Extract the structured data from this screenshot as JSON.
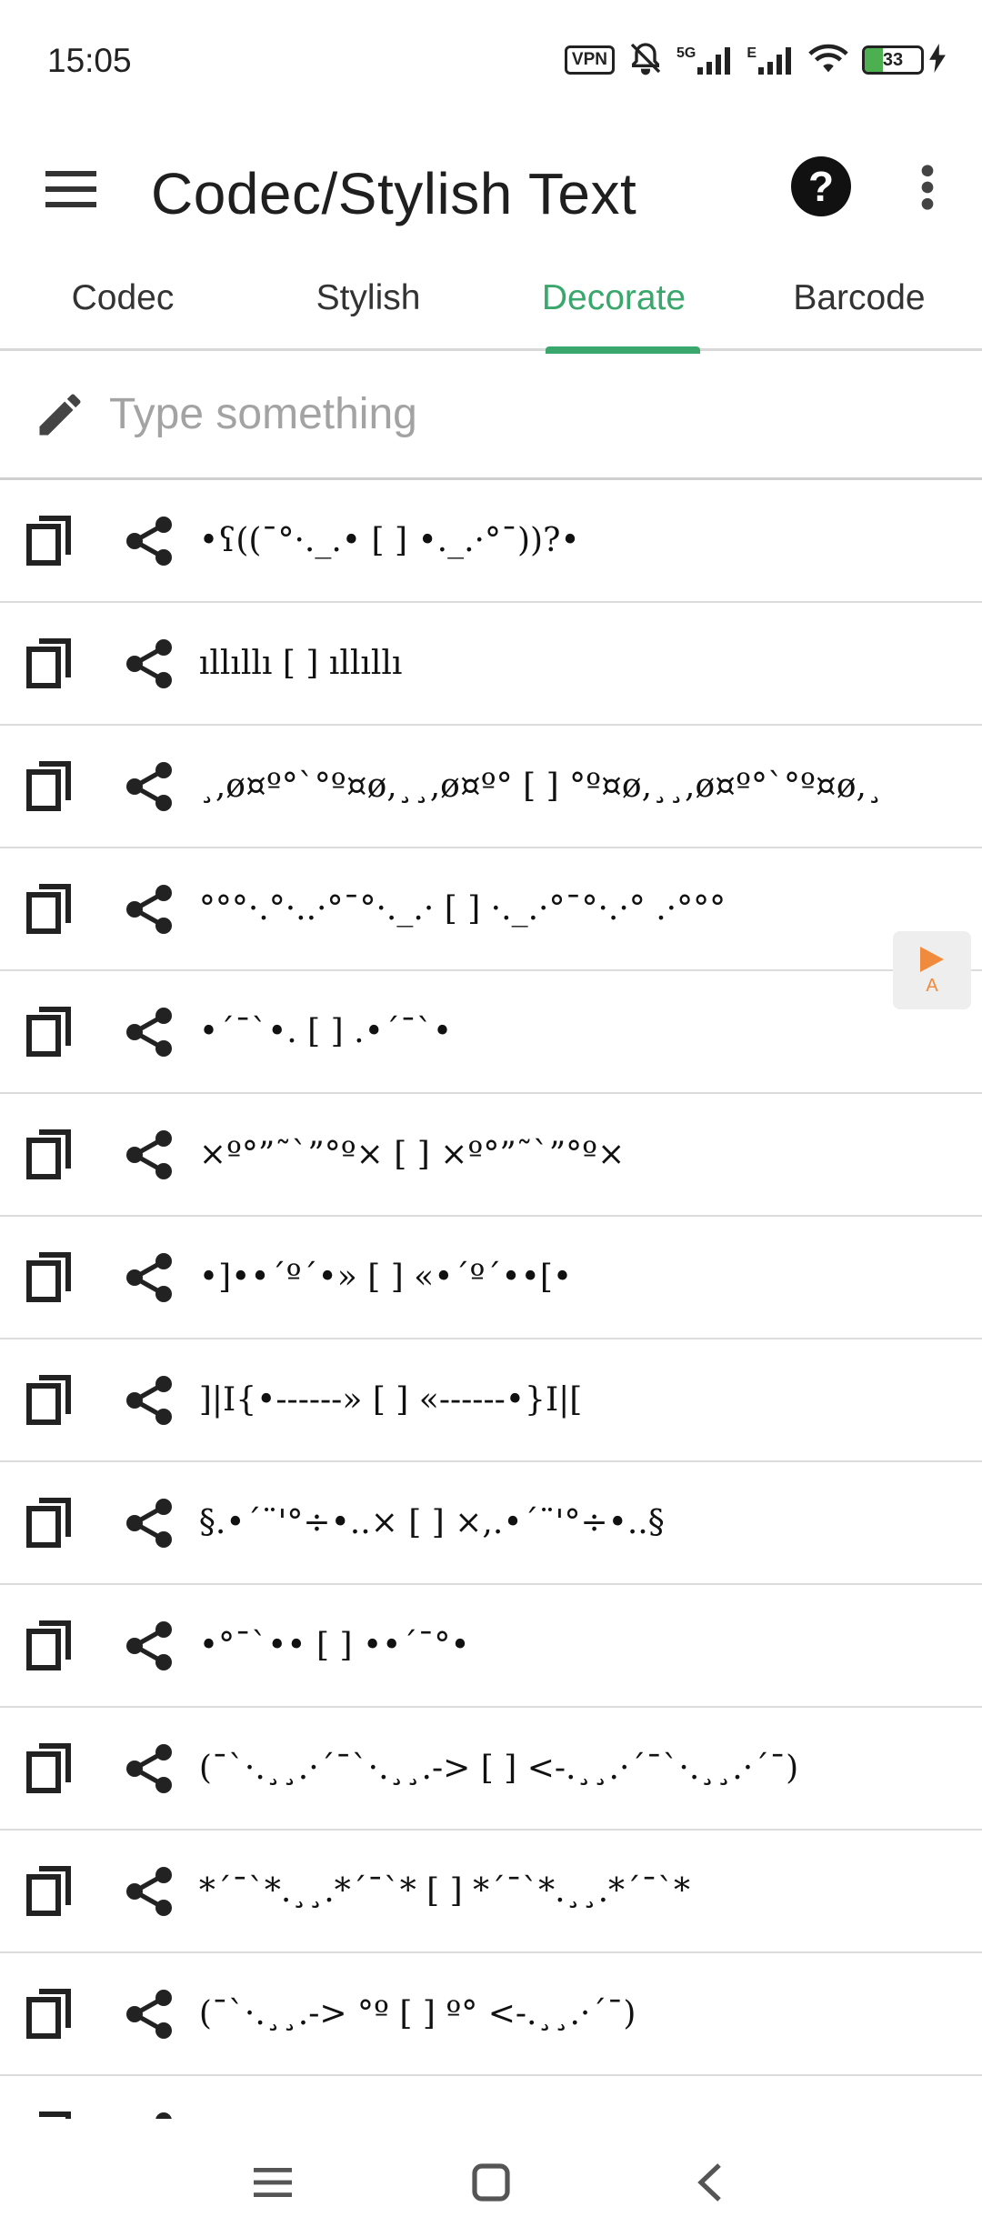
{
  "status_bar": {
    "time": "15:05",
    "vpn": "VPN",
    "network": "5G",
    "network2": "E",
    "battery": "33",
    "battery_level": 0.33
  },
  "app_bar": {
    "title": "Codec/Stylish Text",
    "help": "?"
  },
  "tabs": [
    {
      "label": "Codec"
    },
    {
      "label": "Stylish"
    },
    {
      "label": "Decorate"
    },
    {
      "label": "Barcode"
    }
  ],
  "active_tab": "Decorate",
  "input": {
    "placeholder": "Type something",
    "value": ""
  },
  "rows": [
    {
      "text": "•ʕ((¯°·._.• [  ] •._.·°¯))?•"
    },
    {
      "text": "ıllıllı [  ] ıllıllı"
    },
    {
      "text": "¸,ø¤º°`°º¤ø,¸¸,ø¤º° [  ] °º¤ø,¸¸,ø¤º°`°º¤ø,¸"
    },
    {
      "text": "°°°·.°·..·°¯°·._.· [  ] ·._.·°¯°·.·° .·°°°"
    },
    {
      "text": "•´¯`•. [  ] .•´¯`•"
    },
    {
      "text": "×º°”˜`”°º× [  ] ×º°”˜`”°º×"
    },
    {
      "text": "•]••´º´•» [  ] «•´º´••[•"
    },
    {
      "text": "]|I{•------» [  ] «------•}I|["
    },
    {
      "text": "§.•´¨'°÷•..× [  ] ×,.•´¨'°÷•..§"
    },
    {
      "text": "•°¯`•• [  ] ••´¯°•"
    },
    {
      "text": "(¯`·.¸¸.·´¯`·.¸¸.-> [  ] <-.¸¸.·´¯`·.¸¸.·´¯)"
    },
    {
      "text": "*´¯`*.¸¸.*´¯`* [  ] *´¯`*.¸¸.*´¯`*"
    },
    {
      "text": "(¯`·.¸¸.-> °º [  ] º° <-.¸¸.·´¯)"
    },
    {
      "text": ""
    }
  ],
  "floating_button": {
    "label": "A",
    "accent": "#f08a3c"
  },
  "colors": {
    "accent": "#3aa76d"
  },
  "icons": {
    "menu": "menu-icon",
    "help": "help-icon",
    "more": "more-vert-icon",
    "pencil": "pencil-icon",
    "copy": "copy-icon",
    "share": "share-icon",
    "nav_menu": "nav-recents-icon",
    "nav_home": "nav-home-icon",
    "nav_back": "nav-back-icon"
  }
}
